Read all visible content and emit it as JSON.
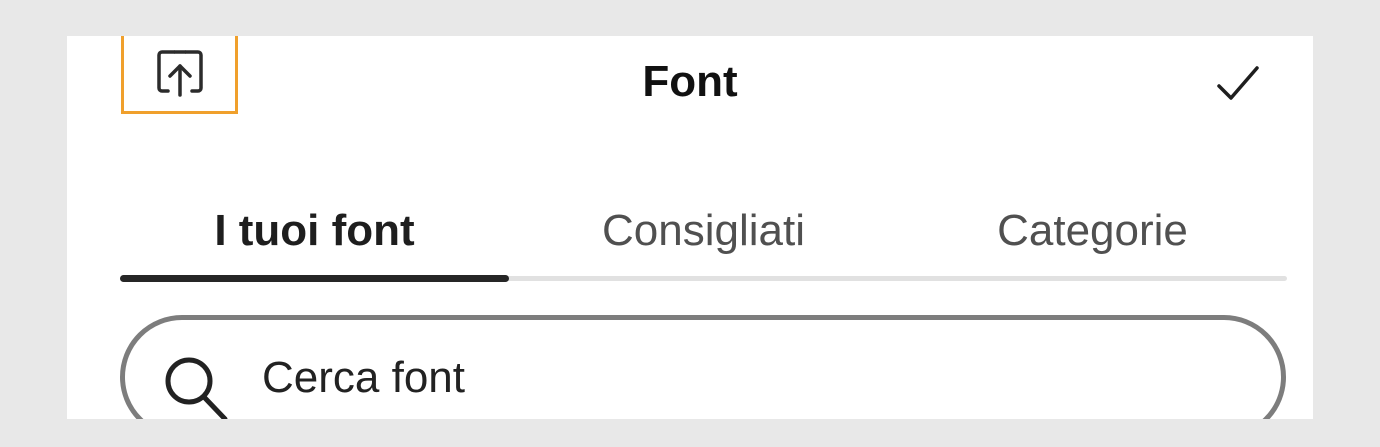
{
  "header": {
    "title": "Font",
    "upload_icon": "upload-icon",
    "confirm_icon": "checkmark-icon"
  },
  "tabs": [
    {
      "label": "I tuoi font",
      "active": true
    },
    {
      "label": "Consigliati",
      "active": false
    },
    {
      "label": "Categorie",
      "active": false
    }
  ],
  "search": {
    "placeholder": "Cerca font",
    "icon": "search-icon"
  },
  "colors": {
    "highlight_border": "#f0a02c",
    "active_tab_indicator": "#262626",
    "tab_track": "#e1e1e1",
    "search_border": "#7d7d7d",
    "background": "#e8e8e8",
    "panel": "#ffffff"
  }
}
